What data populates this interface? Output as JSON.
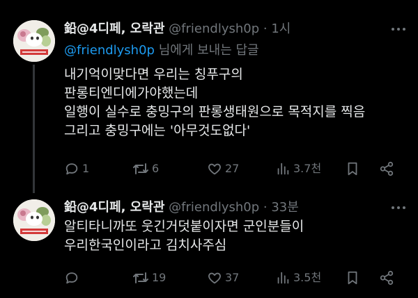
{
  "tweets": [
    {
      "name": "鉛@4디페, 오락관",
      "handle": "@friendlysh0p",
      "separator": "·",
      "time": "1시",
      "reply_to_mention": "@friendlysh0p",
      "reply_to_suffix": " 님에게 보내는 답글",
      "lines": [
        "내기억이맞다면 우리는 칭푸구의",
        "판롱티엔디에가야했는데",
        "일행이 실수로 충밍구의 판롱생태원으로 목적지를 찍음",
        "그리고 충밍구에는 '아무것도없다'"
      ],
      "counts": {
        "replies": "1",
        "retweets": "6",
        "likes": "27",
        "views": "3.7천"
      }
    },
    {
      "name": "鉛@4디페, 오락관",
      "handle": "@friendlysh0p",
      "separator": "·",
      "time": "33분",
      "lines": [
        "알티타니까또 웃긴거덧붙이자면 군인분들이",
        "우리한국인이라고 김치사주심"
      ],
      "counts": {
        "replies": "",
        "retweets": "19",
        "likes": "37",
        "views": "3.5천"
      }
    }
  ],
  "icons": {
    "reply": "comment-icon",
    "retweet": "retweet-icon",
    "like": "heart-icon",
    "views": "views-bar-chart-icon",
    "bookmark": "bookmark-icon",
    "share": "share-icon",
    "more": "more-dots-icon"
  },
  "colors": {
    "background": "#000000",
    "text": "#e7e9ea",
    "muted": "#71767b",
    "link": "#1d9bf0",
    "thread_line": "#333639"
  }
}
